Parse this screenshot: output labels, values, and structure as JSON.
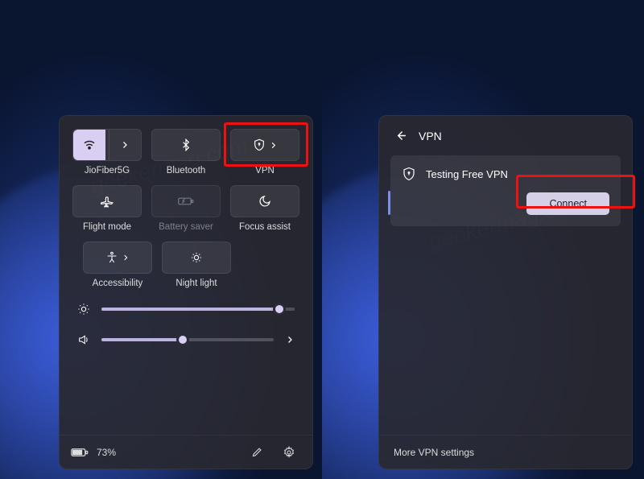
{
  "watermark": "geekermag.com",
  "quick_settings": {
    "tiles": {
      "wifi": {
        "label": "JioFiber5G"
      },
      "bluetooth": {
        "label": "Bluetooth"
      },
      "vpn": {
        "label": "VPN"
      },
      "flight_mode": {
        "label": "Flight mode"
      },
      "battery_saver": {
        "label": "Battery saver"
      },
      "focus_assist": {
        "label": "Focus assist"
      },
      "accessibility": {
        "label": "Accessibility"
      },
      "night_light": {
        "label": "Night light"
      }
    },
    "sliders": {
      "brightness": {
        "value": 92
      },
      "volume": {
        "value": 47
      }
    },
    "footer": {
      "battery_text": "73%"
    }
  },
  "vpn_panel": {
    "title": "VPN",
    "items": [
      {
        "name": "Testing Free VPN",
        "connect_label": "Connect"
      }
    ],
    "footer_link": "More VPN settings"
  }
}
